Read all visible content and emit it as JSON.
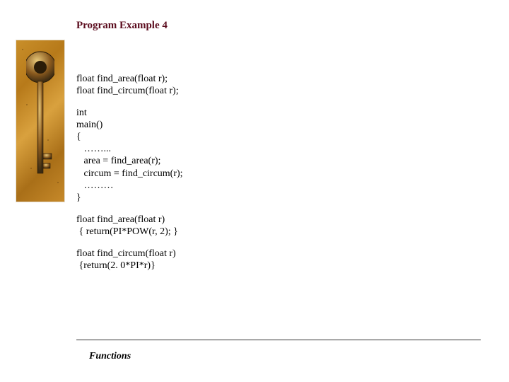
{
  "slide": {
    "title": "Program Example 4",
    "footer": "Functions",
    "sidebar_decoration": "key-image"
  },
  "code": {
    "decl1": "float find_area(float r);",
    "decl2": "float find_circum(float r);",
    "main_kw_int": "int",
    "main_sig": "main()",
    "brace_open": "{",
    "dots1": "   ……...",
    "main_line1": "   area = find_area(r);",
    "main_line2": "   circum = find_circum(r);",
    "dots2": "   ………",
    "brace_close": "}",
    "func1_sig": "float find_area(float r)",
    "func1_body": " { return(PI*POW(r, 2); }",
    "func2_sig": "float find_circum(float r)",
    "func2_body": " {return(2. 0*PI*r)}"
  }
}
